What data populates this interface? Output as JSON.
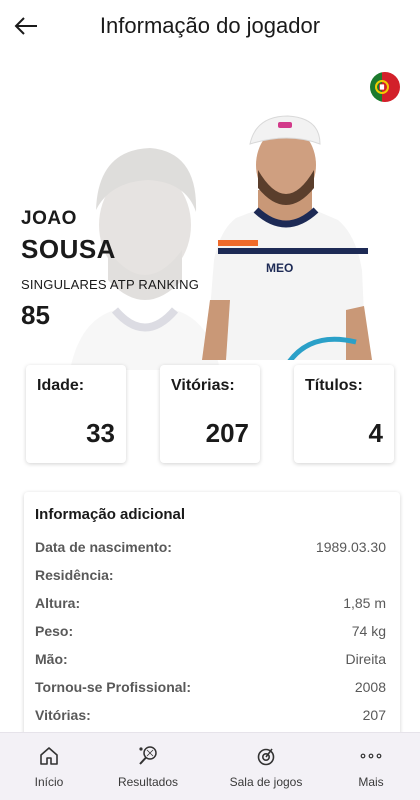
{
  "header": {
    "title": "Informação do jogador"
  },
  "player": {
    "first_name": "JOAO",
    "last_name": "SOUSA",
    "ranking_label": "SINGULARES ATP RANKING",
    "ranking_value": "85",
    "shirt_logo": "MEO",
    "country_flag": "flag-portugal-icon"
  },
  "stats": [
    {
      "label": "Idade:",
      "value": "33"
    },
    {
      "label": "Vitórias:",
      "value": "207"
    },
    {
      "label": "Títulos:",
      "value": "4"
    }
  ],
  "info": {
    "title": "Informação adicional",
    "rows": [
      {
        "key": "Data de nascimento:",
        "value": "1989.03.30"
      },
      {
        "key": "Residência:",
        "value": ""
      },
      {
        "key": "Altura:",
        "value": "1,85 m"
      },
      {
        "key": "Peso:",
        "value": "74 kg"
      },
      {
        "key": "Mão:",
        "value": "Direita"
      },
      {
        "key": "Tornou-se Profissional:",
        "value": "2008"
      },
      {
        "key": "Vitórias:",
        "value": "207"
      }
    ]
  },
  "nav": {
    "items": [
      {
        "label": "Início",
        "icon": "home-icon"
      },
      {
        "label": "Resultados",
        "icon": "tennis-racket-icon"
      },
      {
        "label": "Sala de jogos",
        "icon": "target-icon"
      },
      {
        "label": "Mais",
        "icon": "more-dots-icon"
      }
    ]
  }
}
